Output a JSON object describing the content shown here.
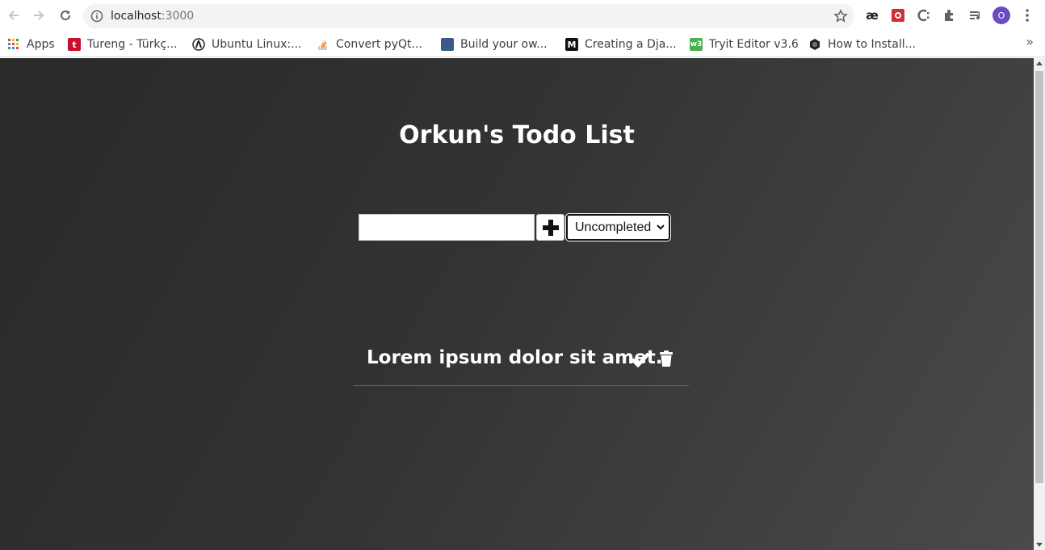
{
  "browser": {
    "url_host": "localhost",
    "url_port": ":3000",
    "avatar_letter": "O",
    "more_bookmarks": "»"
  },
  "bookmarks": [
    {
      "label": "Apps",
      "icon": "apps-grid-icon"
    },
    {
      "label": "Tureng - Türkç...",
      "icon": "tureng-icon"
    },
    {
      "label": "Ubuntu Linux:...",
      "icon": "ubuntu-icon"
    },
    {
      "label": "Convert pyQt...",
      "icon": "stackoverflow-icon"
    },
    {
      "label": "Build your ow...",
      "icon": "page-icon"
    },
    {
      "label": "Creating a Dja...",
      "icon": "medium-icon"
    },
    {
      "label": "Tryit Editor v3.6",
      "icon": "w3schools-icon"
    },
    {
      "label": "How to Install...",
      "icon": "hexagon-icon"
    }
  ],
  "app": {
    "title": "Orkun's Todo List",
    "input_value": "",
    "filter_selected": "Uncompleted",
    "todos": [
      {
        "text": "Lorem ipsum dolor sit amet."
      }
    ]
  },
  "colors": {
    "background_dark": "#2a2a2a",
    "background_light": "#4a4a4a",
    "text": "#ffffff"
  }
}
